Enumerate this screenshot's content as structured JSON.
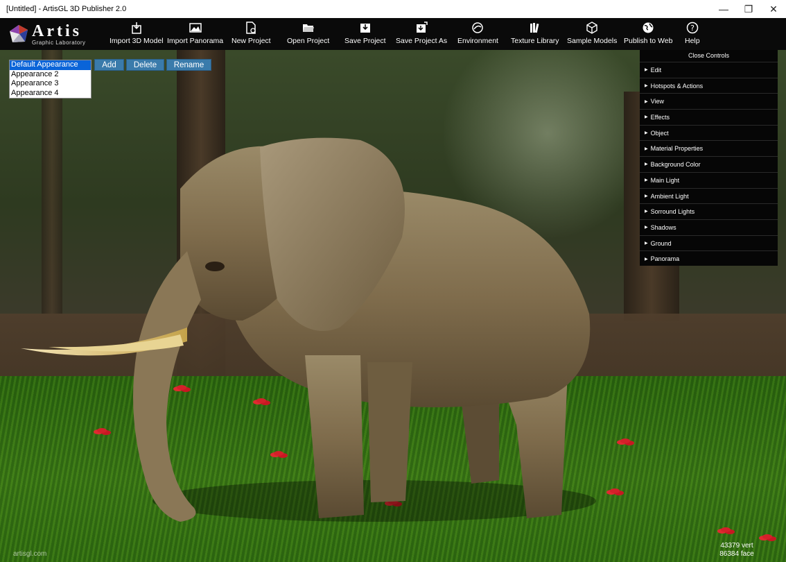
{
  "window": {
    "title": "[Untitled] - ArtisGL 3D Publisher 2.0",
    "minimize_glyph": "—",
    "restore_glyph": "❐",
    "close_glyph": "✕"
  },
  "logo": {
    "name": "Artis",
    "subtitle": "Graphic Laboratory"
  },
  "toolbar": {
    "items": [
      {
        "label": "Import 3D Model",
        "icon": "import-model-icon"
      },
      {
        "label": "Import Panorama",
        "icon": "panorama-icon"
      },
      {
        "label": "New Project",
        "icon": "new-project-icon"
      },
      {
        "label": "Open Project",
        "icon": "folder-open-icon"
      },
      {
        "label": "Save Project",
        "icon": "save-icon"
      },
      {
        "label": "Save Project As",
        "icon": "save-as-icon"
      },
      {
        "label": "Environment",
        "icon": "environment-icon"
      },
      {
        "label": "Texture Library",
        "icon": "library-icon"
      },
      {
        "label": "Sample Models",
        "icon": "cube-icon"
      },
      {
        "label": "Publish to Web",
        "icon": "globe-icon"
      },
      {
        "label": "Help",
        "icon": "help-icon"
      }
    ]
  },
  "appearances": {
    "items": [
      "Default Appearance",
      "Appearance 2",
      "Appearance 3",
      "Appearance 4"
    ],
    "selected": "Default Appearance",
    "add_label": "Add",
    "delete_label": "Delete",
    "rename_label": "Rename"
  },
  "controls": {
    "header": "Close Controls",
    "items": [
      "Edit",
      "Hotspots & Actions",
      "View",
      "Effects",
      "Object",
      "Material Properties",
      "Background Color",
      "Main Light",
      "Ambient Light",
      "Sorround Lights",
      "Shadows",
      "Ground",
      "Panorama"
    ]
  },
  "stats": {
    "vertices": "43379 vert",
    "faces": "86384 face"
  },
  "watermark": "artisgl.com",
  "colors": {
    "accent_button": "#3a7bab",
    "selection": "#0a64d8",
    "toolbar_bg": "#0a0a0a"
  }
}
